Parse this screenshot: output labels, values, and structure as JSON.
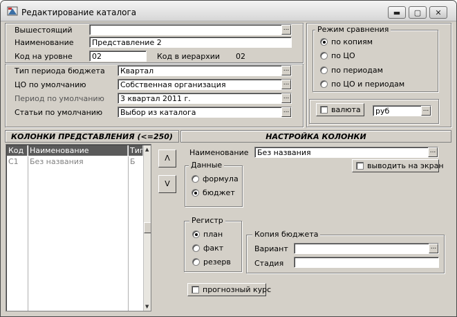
{
  "window": {
    "title": "Редактирование каталога",
    "minimize": "▬",
    "maximize": "▢",
    "close": "✕"
  },
  "top": {
    "parent_label": "Вышестоящий",
    "parent_value": "",
    "name_label": "Наименование",
    "name_value": "Представление 2",
    "level_code_label": "Код на уровне",
    "level_code_value": "02",
    "hier_code_label": "Код в иерархии",
    "hier_code_value": "02"
  },
  "defaults": {
    "period_type_label": "Тип периода бюджета",
    "period_type_value": "Квартал",
    "co_label": "ЦО по умолчанию",
    "co_value": "Собственная организация",
    "period_label": "Период по умолчанию",
    "period_value": "3 квартал 2011 г.",
    "articles_label": "Статьи по умолчанию",
    "articles_value": "Выбор из каталога"
  },
  "compare": {
    "title": "Режим сравнения",
    "options": [
      "по копиям",
      "по ЦО",
      "по периодам",
      "по ЦО и периодам"
    ],
    "selected_index": 0,
    "currency_label": "валюта",
    "currency_checked": false,
    "currency_value": "руб"
  },
  "columns": {
    "header": "КОЛОНКИ ПРЕДСТАВЛЕНИЯ (<=250)",
    "grid_headers": [
      "Код",
      "Наименование",
      "Тип"
    ],
    "rows": [
      {
        "code": "С1",
        "name": "Без названия",
        "type": "Б"
      }
    ],
    "up_label": "Λ",
    "down_label": "V"
  },
  "settings": {
    "header": "НАСТРОЙКА КОЛОНКИ",
    "name_label": "Наименование",
    "name_value": "Без названия",
    "show_label": "выводить на экран",
    "show_checked": false,
    "data_title": "Данные",
    "data_options": [
      "формула",
      "бюджет"
    ],
    "data_selected": 1,
    "register_title": "Регистр",
    "register_options": [
      "план",
      "факт",
      "резерв"
    ],
    "register_selected": 0,
    "copy_title": "Копия бюджета",
    "variant_label": "Вариант",
    "variant_value": "",
    "stage_label": "Стадия",
    "stage_value": "",
    "forecast_label": "прогнозный курс",
    "forecast_checked": false
  },
  "icons": {
    "ellipsis": "...",
    "scroll_up": "▲",
    "scroll_down": "▼"
  }
}
